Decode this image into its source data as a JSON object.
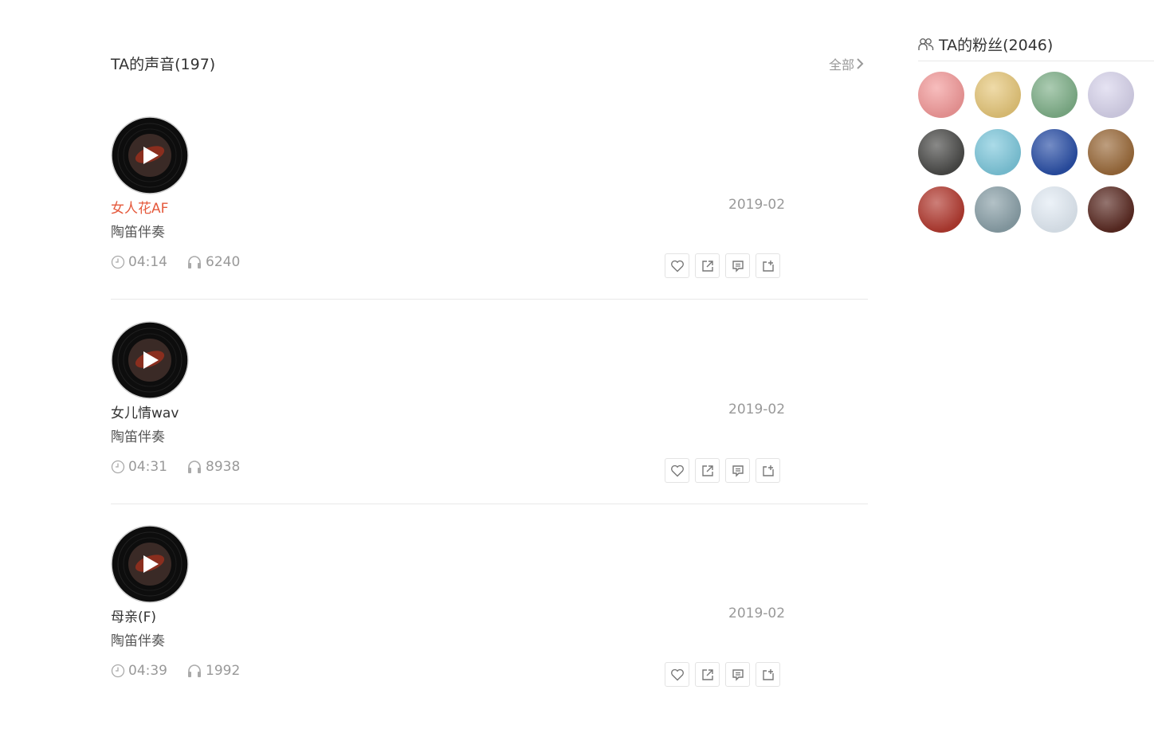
{
  "section": {
    "title": "TA的声音(197)",
    "all_label": "全部"
  },
  "tracks": [
    {
      "title": "女人花AF",
      "subtitle": "陶笛伴奏",
      "date": "2019-02",
      "duration": "04:14",
      "plays": "6240",
      "highlight": true
    },
    {
      "title": "女儿情wav",
      "subtitle": "陶笛伴奏",
      "date": "2019-02",
      "duration": "04:31",
      "plays": "8938",
      "highlight": false
    },
    {
      "title": "母亲(F)",
      "subtitle": "陶笛伴奏",
      "date": "2019-02",
      "duration": "04:39",
      "plays": "1992",
      "highlight": false
    }
  ],
  "track_actions": [
    "like-icon",
    "share-icon",
    "comment-icon",
    "add-to-list-icon"
  ],
  "fans": {
    "title": "TA的粉丝(2046)",
    "avatars": [
      {
        "name": "fan-avatar-1",
        "color": "#f39a9a"
      },
      {
        "name": "fan-avatar-2",
        "color": "#e6c77a"
      },
      {
        "name": "fan-avatar-3",
        "color": "#7fb089"
      },
      {
        "name": "fan-avatar-4",
        "color": "#d8d4ec"
      },
      {
        "name": "fan-avatar-5",
        "color": "#4a4a48"
      },
      {
        "name": "fan-avatar-6",
        "color": "#7ec8dc"
      },
      {
        "name": "fan-avatar-7",
        "color": "#2a4fa6"
      },
      {
        "name": "fan-avatar-8",
        "color": "#9a6a3a"
      },
      {
        "name": "fan-avatar-9",
        "color": "#b23a30"
      },
      {
        "name": "fan-avatar-10",
        "color": "#8aa0a8"
      },
      {
        "name": "fan-avatar-11",
        "color": "#e2ebf4"
      },
      {
        "name": "fan-avatar-12",
        "color": "#5a2a22"
      }
    ]
  },
  "colors": {
    "accent": "#e55a3d",
    "muted": "#999999",
    "divider": "#e8e8e8"
  }
}
